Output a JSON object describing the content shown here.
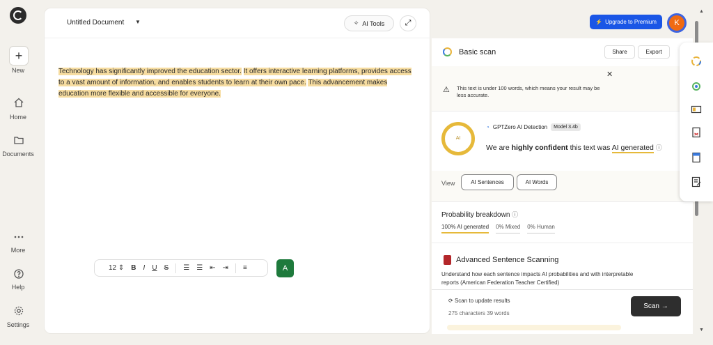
{
  "rail": {
    "new_label": "New",
    "items": [
      {
        "label": "Home",
        "icon": "home-icon"
      },
      {
        "label": "Documents",
        "icon": "folder-icon"
      },
      {
        "label": "More",
        "icon": "more-icon"
      },
      {
        "label": "Help",
        "icon": "help-icon"
      },
      {
        "label": "Settings",
        "icon": "settings-icon"
      }
    ]
  },
  "editor": {
    "title": "Untitled Document",
    "ai_tools_label": "AI Tools",
    "body": [
      "Technology has significantly improved the education sector.",
      "It offers interactive learning platforms, provides access to a vast amount of information, and enables students to learn at their own pace.",
      "This advancement makes education more flexible and accessible for everyone."
    ],
    "font_size": "12"
  },
  "header": {
    "upgrade_label": "Upgrade to Premium",
    "avatar_initial": "K"
  },
  "results": {
    "title": "Basic scan",
    "share_label": "Share",
    "export_label": "Export",
    "warning": "This text is under 100 words, which means your result may be less accurate.",
    "ring_label": "AI",
    "detector_name": "GPTZero AI Detection",
    "model_badge": "Model 3.4b",
    "verdict_prefix": "We are ",
    "verdict_strong": "highly confident",
    "verdict_mid": " this text was ",
    "verdict_label": "AI generated",
    "view_label": "View",
    "view_buttons": [
      "AI Sentences",
      "AI Words"
    ],
    "prob_title": "Probability breakdown",
    "prob_tabs": [
      "100% AI generated",
      "0% Mixed",
      "0% Human"
    ],
    "adv_title": "Advanced Sentence Scanning",
    "adv_text": "Understand how each sentence impacts AI probabilities and with interpretable reports (American Federation Teacher Certified)",
    "footer_status": "Scan to update results",
    "footer_count": "275 characters 39 words",
    "scan_button": "Scan"
  },
  "colors": {
    "accent_blue": "#1a56e6",
    "highlight": "#f6dca0",
    "ai_gold": "#e6b93a",
    "grammar_green": "#1e7a3c"
  }
}
